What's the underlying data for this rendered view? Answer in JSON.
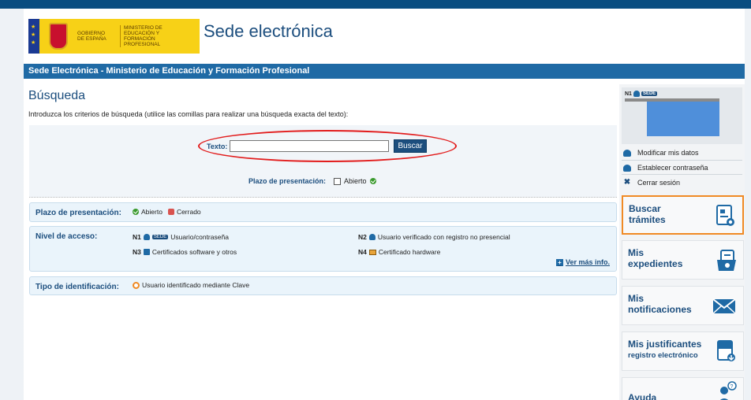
{
  "header": {
    "gobierno": "GOBIERNO DE ESPAÑA",
    "ministerio": "MINISTERIO DE EDUCACIÓN Y FORMACIÓN PROFESIONAL",
    "title": "Sede electrónica"
  },
  "bluebar": {
    "text": "Sede Electrónica - Ministerio de Educación y Formación Profesional"
  },
  "search": {
    "title": "Búsqueda",
    "intro": "Introduzca los criterios de búsqueda (utilice las comillas para realizar una búsqueda exacta del texto):",
    "texto_label": "Texto:",
    "texto_value": "",
    "button_label": "Buscar",
    "plazo_label": "Plazo de presentación:",
    "abierto_label": "Abierto",
    "abierto_checked": false
  },
  "legend": {
    "plazo": {
      "title": "Plazo de presentación:",
      "abierto": "Abierto",
      "cerrado": "Cerrado"
    },
    "nivel": {
      "title": "Nivel de acceso:",
      "items": [
        {
          "level": "N1",
          "badge": "SEDE",
          "text": "Usuario/contraseña"
        },
        {
          "level": "N2",
          "text": "Usuario verificado con registro no presencial"
        },
        {
          "level": "N3",
          "text": "Certificados software y otros"
        },
        {
          "level": "N4",
          "text": "Certificado hardware"
        }
      ],
      "ver_mas": "Ver más info."
    },
    "tipo": {
      "title": "Tipo de identificación:",
      "text": "Usuario identificado mediante Clave"
    }
  },
  "sidebar": {
    "user_level": "N1",
    "user_badge": "SEDE",
    "menu": [
      {
        "label": "Modificar mis datos",
        "icon": "user-edit-icon"
      },
      {
        "label": "Establecer contraseña",
        "icon": "user-key-icon"
      },
      {
        "label": "Cerrar sesión",
        "icon": "close-icon"
      }
    ],
    "boxes": [
      {
        "title": "Buscar trámites",
        "sub": "",
        "icon": "search-document-icon"
      },
      {
        "title": "Mis expedientes",
        "sub": "",
        "icon": "folder-icon"
      },
      {
        "title": "Mis notificaciones",
        "sub": "",
        "icon": "mail-icon"
      },
      {
        "title": "Mis justificantes",
        "sub": "registro electrónico",
        "icon": "receipt-download-icon"
      },
      {
        "title": "Ayuda",
        "sub": "",
        "icon": "help-user-icon"
      }
    ]
  },
  "colors": {
    "primary": "#1c4e7e",
    "bar": "#1f6aa5",
    "highlight": "#e21c1c",
    "accent": "#f08a24"
  }
}
